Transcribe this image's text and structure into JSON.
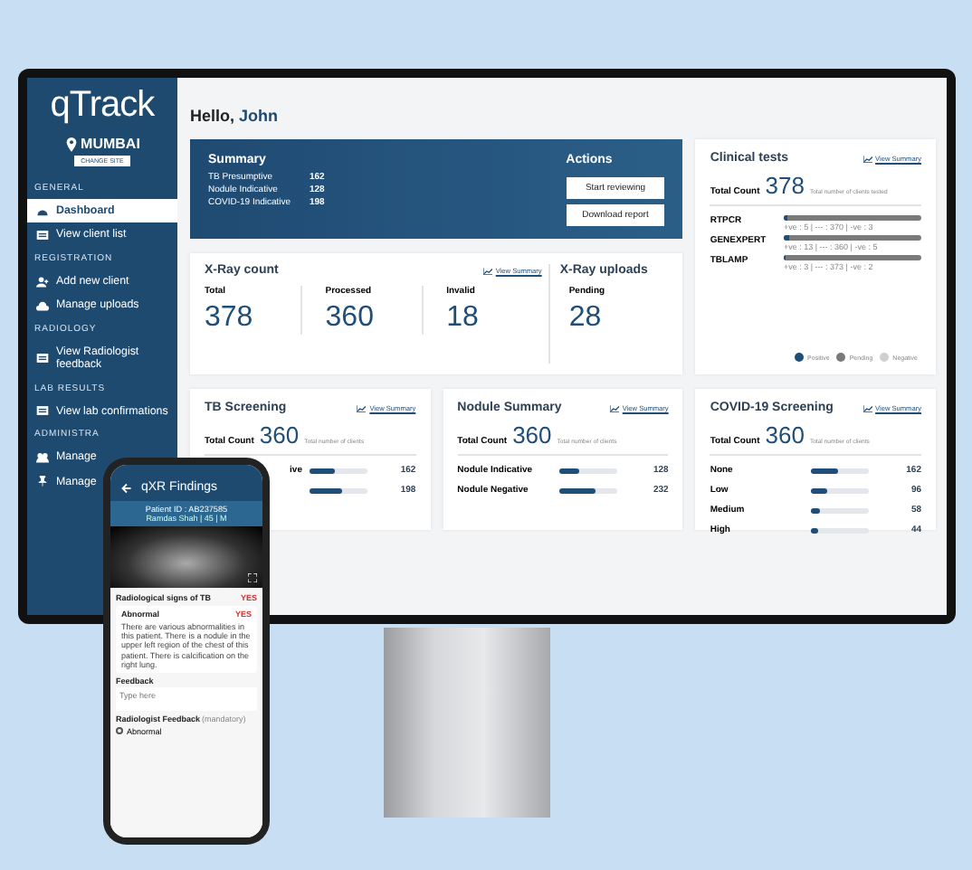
{
  "sidebar": {
    "logo": "qTrack",
    "location": "MUMBAI",
    "change_site": "CHANGE SITE",
    "sections": [
      {
        "heading": "GENERAL",
        "items": [
          {
            "label": "Dashboard",
            "kind": "gauge",
            "selected": true
          },
          {
            "label": "View client list",
            "kind": "card",
            "selected": false
          }
        ]
      },
      {
        "heading": "REGISTRATION",
        "items": [
          {
            "label": "Add new client",
            "kind": "user-add",
            "selected": false
          },
          {
            "label": "Manage uploads",
            "kind": "upload",
            "selected": false
          }
        ]
      },
      {
        "heading": "RADIOLOGY",
        "items": [
          {
            "label": "View Radiologist feedback",
            "kind": "card",
            "selected": false
          }
        ]
      },
      {
        "heading": "LAB RESULTS",
        "items": [
          {
            "label": "View lab confirmations",
            "kind": "card",
            "selected": false
          }
        ]
      },
      {
        "heading": "ADMINISTRA",
        "items": [
          {
            "label": "Manage",
            "kind": "group",
            "selected": false
          },
          {
            "label": "Manage",
            "kind": "pin",
            "selected": false
          }
        ]
      }
    ]
  },
  "greeting": {
    "prefix": "Hello,",
    "name": "John"
  },
  "summary": {
    "title": "Summary",
    "rows": [
      {
        "label": "TB Presumptive",
        "value": "162"
      },
      {
        "label": "Nodule Indicative",
        "value": "128"
      },
      {
        "label": "COVID-19 Indicative",
        "value": "198"
      }
    ]
  },
  "actions": {
    "title": "Actions",
    "buttons": [
      "Start reviewing",
      "Download report"
    ]
  },
  "xray": {
    "title": "X-Ray count",
    "link": "View Summary",
    "stats": [
      {
        "label": "Total",
        "value": "378"
      },
      {
        "label": "Processed",
        "value": "360"
      },
      {
        "label": "Invalid",
        "value": "18"
      }
    ],
    "uploads": {
      "title": "X-Ray uploads",
      "label": "Pending",
      "value": "28"
    }
  },
  "clinical": {
    "title": "Clinical tests",
    "link": "View Summary",
    "total_label": "Total Count",
    "total": "378",
    "total_note": "Total number of clients tested",
    "tests": [
      {
        "name": "RTPCR",
        "level": 0.02,
        "reading": "+ve : 5 | --- : 370 | -ve : 3"
      },
      {
        "name": "GENEXPERT",
        "level": 0.04,
        "reading": "+ve : 13 | --- : 360 | -ve : 5"
      },
      {
        "name": "TBLAMP",
        "level": 0.01,
        "reading": "+ve : 3 | --- : 373 | -ve : 2"
      }
    ],
    "legend": [
      {
        "label": "Positive",
        "color": "#1f4e79"
      },
      {
        "label": "Pending",
        "color": "#7a7a7a"
      },
      {
        "label": "Negative",
        "color": "#cfcfcf"
      }
    ]
  },
  "screenings": [
    {
      "title": "TB Screening",
      "link": "View Summary",
      "total_label": "Total Count",
      "total": "360",
      "total_note": "Total number of clients",
      "rows": [
        {
          "label": "ive",
          "level": 0.45,
          "value": "162"
        },
        {
          "level": 0.55,
          "value": "198"
        }
      ]
    },
    {
      "title": "Nodule Summary",
      "link": "View Summary",
      "total_label": "Total Count",
      "total": "360",
      "total_note": "Total number of clients",
      "rows": [
        {
          "label": "Nodule Indicative",
          "level": 0.36,
          "value": "128"
        },
        {
          "label": "Nodule Negative",
          "level": 0.64,
          "value": "232"
        }
      ]
    },
    {
      "title": "COVID-19 Screening",
      "link": "View Summary",
      "total_label": "Total Count",
      "total": "360",
      "total_note": "Total number of clients",
      "rows": [
        {
          "label": "None",
          "level": 0.45,
          "value": "162"
        },
        {
          "label": "Low",
          "level": 0.27,
          "value": "96"
        },
        {
          "label": "Medium",
          "level": 0.16,
          "value": "58"
        },
        {
          "label": "High",
          "level": 0.12,
          "value": "44"
        }
      ]
    }
  ],
  "phone": {
    "title": "qXR Findings",
    "patient_id": "Patient ID : AB237585",
    "patient_info": "Ramdas Shah | 45 | M",
    "signs_label": "Radiological signs of TB",
    "signs_value": "YES",
    "abnormal_label": "Abnormal",
    "abnormal_value": "YES",
    "abnormal_text": "There are various abnormalities in this patient. There is a nodule in the upper left region of the chest of this patient. There is calcification on the right lung.",
    "feedback_label": "Feedback",
    "feedback_placeholder": "Type here",
    "radiologist_label": "Radiologist Feedback",
    "radiologist_note": "(mandatory)",
    "options": [
      {
        "label": "Abnormal",
        "selected": false
      }
    ]
  }
}
